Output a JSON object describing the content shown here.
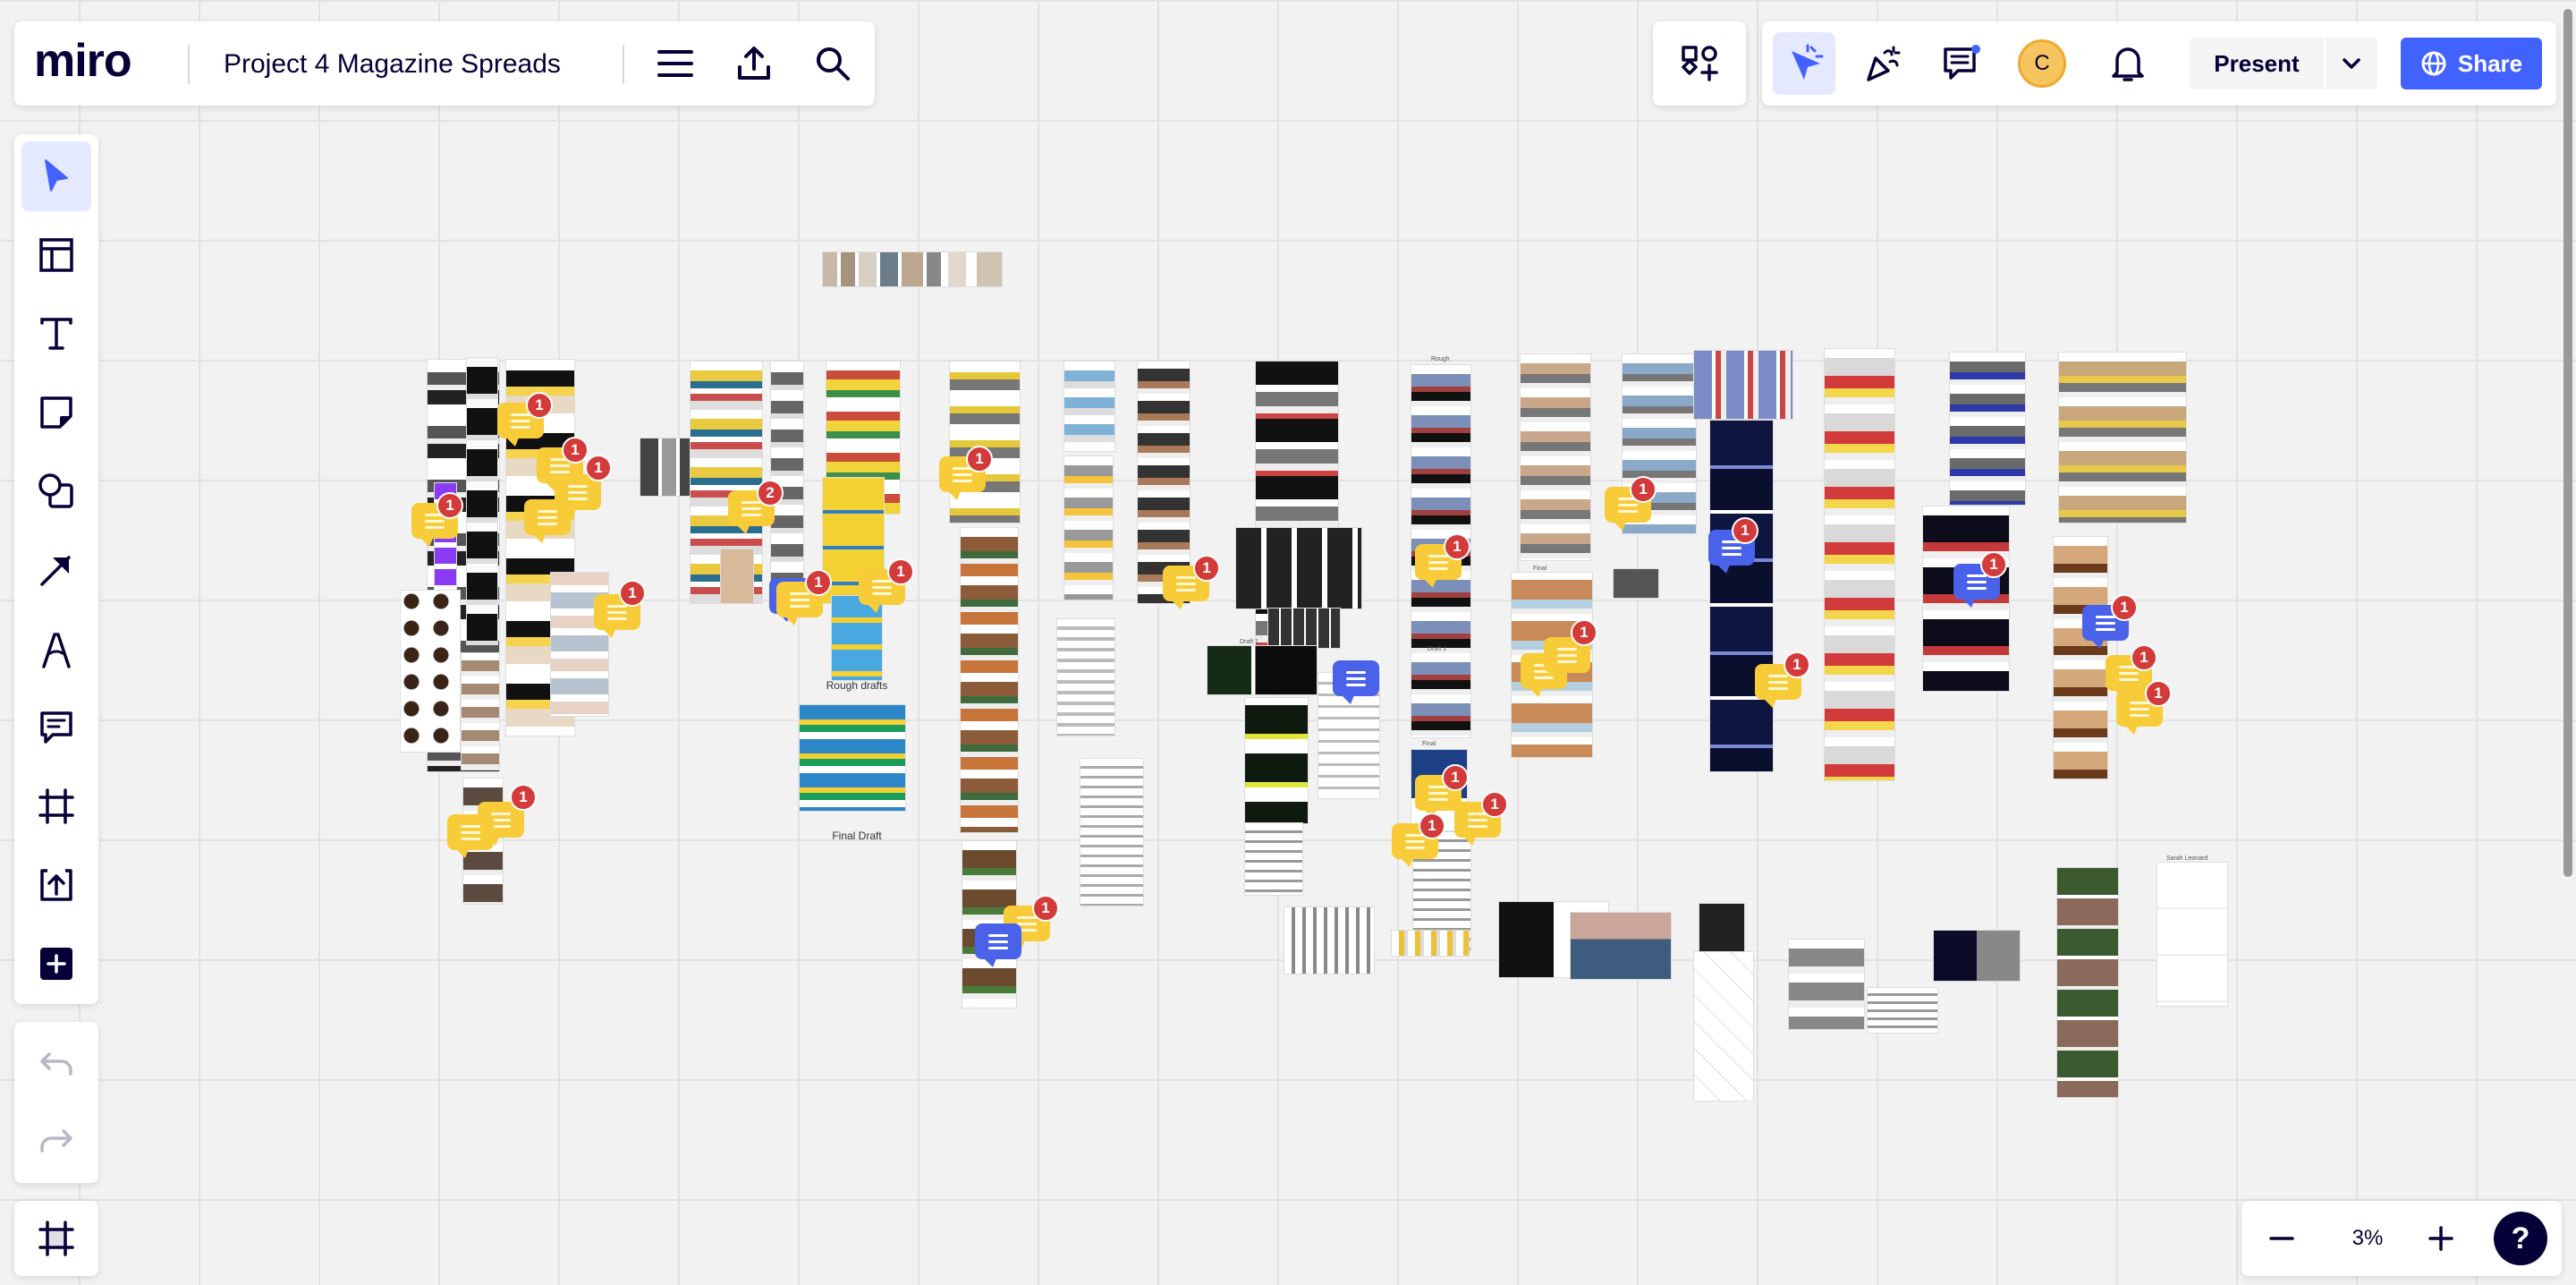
{
  "header": {
    "logo": "miro",
    "board_title": "Project 4 Magazine Spreads",
    "present_label": "Present",
    "share_label": "Share",
    "avatar_initial": "C"
  },
  "board": {
    "labels": {
      "rough_drafts": "Rough drafts",
      "final_draft": "Final Draft",
      "final_1": "Final",
      "final_2": "Final",
      "draft_1": "Draft 1",
      "draft_2": "Draft 2",
      "rough": "Rough",
      "sarah": "Sarah Leonard"
    },
    "comment_counts": [
      "1",
      "1",
      "1",
      "1",
      "1",
      "1",
      "2",
      "1",
      "1",
      "1",
      "1",
      "1",
      "1",
      "1",
      "1",
      "1",
      "1",
      "1",
      "1",
      "1",
      "1",
      "1",
      "1",
      "1",
      "1"
    ]
  },
  "zoom": {
    "level": "3%",
    "help": "?"
  },
  "colors": {
    "accent": "#4262ff",
    "comment": "#f8cc38",
    "badge": "#d33a3a",
    "active_tool_bg": "#e4e9ff"
  },
  "icons": [
    "menu-icon",
    "export-icon",
    "search-icon",
    "apps-icon",
    "reactions-icon",
    "celebrate-icon",
    "comments-icon",
    "bell-icon",
    "chevron-down-icon",
    "globe-icon",
    "select-icon",
    "templates-icon",
    "text-icon",
    "sticky-note-icon",
    "shapes-icon",
    "arrow-icon",
    "pen-icon",
    "comment-icon",
    "frame-icon",
    "upload-icon",
    "plus-icon",
    "undo-icon",
    "redo-icon",
    "frames-panel-icon",
    "zoom-out-icon",
    "zoom-in-icon"
  ]
}
